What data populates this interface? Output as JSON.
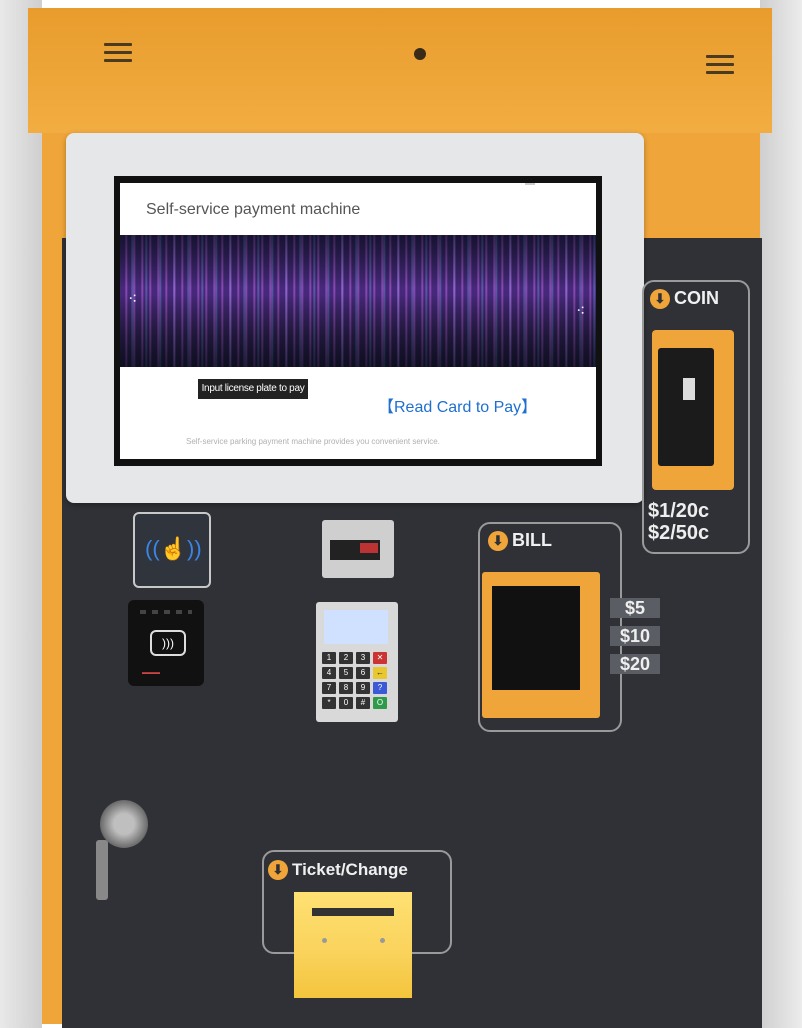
{
  "kiosk": {
    "screen": {
      "title": "Self-service payment machine",
      "prev_arrow": "⁖",
      "next_arrow": "⁖",
      "input_plate_button": "Input license plate to pay",
      "read_card_button": "【Read Card to Pay】",
      "footer": "Self-service parking payment machine provides you convenient service."
    },
    "coin": {
      "label": "COIN",
      "denominations": [
        "$1/20c",
        "$2/50c"
      ]
    },
    "bill": {
      "label": "BILL",
      "denominations": [
        "$5",
        "$10",
        "$20"
      ]
    },
    "ticket": {
      "label": "Ticket/Change"
    },
    "pinpad_keys": [
      "1",
      "2",
      "3",
      "✕",
      "4",
      "5",
      "6",
      "←",
      "7",
      "8",
      "9",
      "?",
      "*",
      "0",
      "#",
      "O"
    ],
    "colors": {
      "body_orange": "#f0a53a",
      "panel_dark": "#2f3136",
      "link_blue": "#1e6fd0",
      "ticket_yellow": "#f9d25a"
    }
  }
}
